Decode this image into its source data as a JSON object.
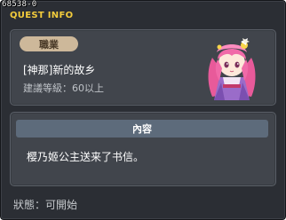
{
  "window": {
    "id_tag": "68538-0",
    "title": "QUEST INFO"
  },
  "job_panel": {
    "badge_label": "職業",
    "quest_name": "[神那]新的故乡",
    "level_requirement": "建議等級：60以上"
  },
  "content_panel": {
    "header": "內容",
    "text": "樱乃姬公主送来了书信。"
  },
  "status_line": "狀態：可開始",
  "npc": {
    "icon": "princess-sakuno-npc-icon"
  },
  "colors": {
    "title": "#f3cc3c",
    "badge": "#cdb89a",
    "content_header": "#5d6b7b"
  }
}
